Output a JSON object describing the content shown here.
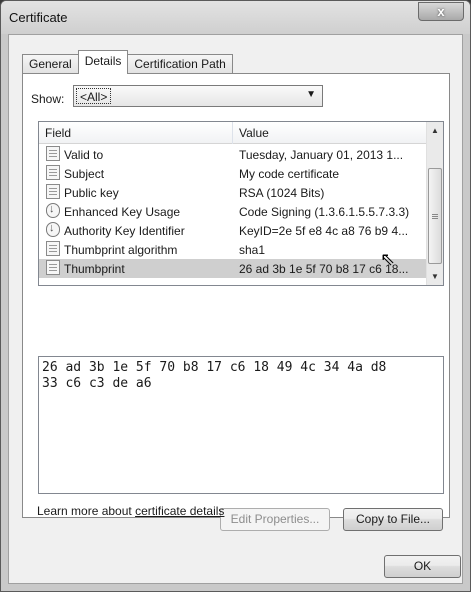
{
  "window": {
    "title": "Certificate",
    "close_glyph": "x"
  },
  "tabs": [
    "General",
    "Details",
    "Certification Path"
  ],
  "show": {
    "label": "Show:",
    "selected": "<All>"
  },
  "list": {
    "columns": [
      "Field",
      "Value"
    ],
    "rows": [
      {
        "field": "Valid to",
        "value": "Tuesday, January 01, 2013 1...",
        "icon": "document-icon"
      },
      {
        "field": "Subject",
        "value": "My code certificate",
        "icon": "document-icon"
      },
      {
        "field": "Public key",
        "value": "RSA (1024 Bits)",
        "icon": "document-icon"
      },
      {
        "field": "Enhanced Key Usage",
        "value": "Code Signing (1.3.6.1.5.5.7.3.3)",
        "icon": "extension-icon"
      },
      {
        "field": "Authority Key Identifier",
        "value": "KeyID=2e 5f e8 4c a8 76 b9 4...",
        "icon": "extension-icon"
      },
      {
        "field": "Thumbprint algorithm",
        "value": "sha1",
        "icon": "document-icon"
      },
      {
        "field": "Thumbprint",
        "value": "26 ad 3b 1e 5f 70 b8 17 c6 18...",
        "icon": "document-icon",
        "selected": true
      }
    ]
  },
  "value_box": {
    "line1": "26 ad 3b 1e 5f 70 b8 17 c6 18 49 4c 34 4a d8",
    "line2": "33 c6 c3 de a6"
  },
  "buttons": {
    "edit": "Edit Properties...",
    "copy": "Copy to File...",
    "ok": "OK"
  },
  "learn": {
    "prefix": "Learn more about ",
    "link": "certificate details"
  }
}
